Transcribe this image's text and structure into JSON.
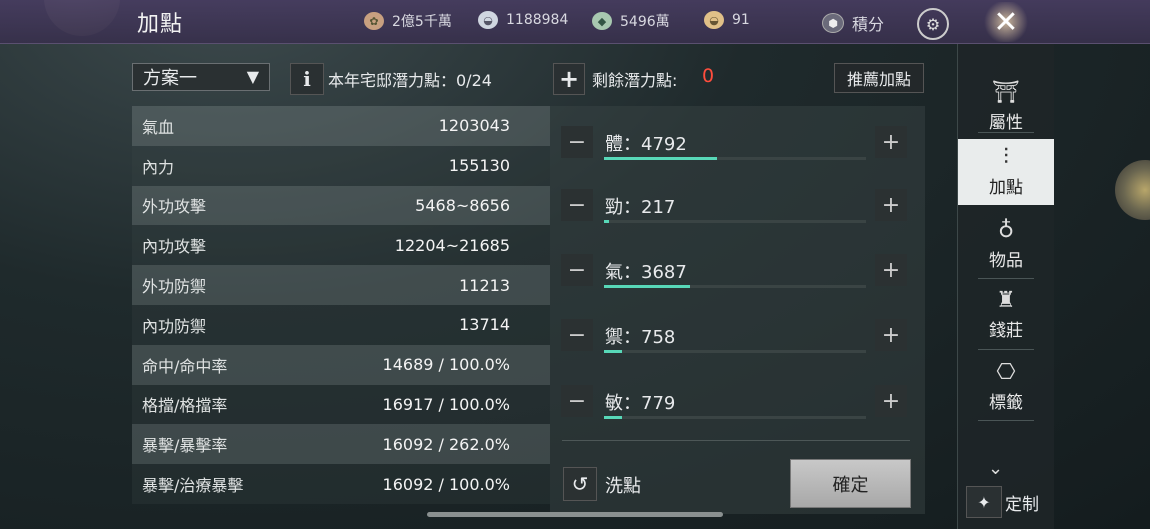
{
  "header": {
    "title": "加點",
    "resources": [
      {
        "icon": "coin-film-icon",
        "value": "2億5千萬"
      },
      {
        "icon": "silver-ingot-icon",
        "value": "1188984"
      },
      {
        "icon": "jade-icon",
        "value": "5496萬"
      },
      {
        "icon": "gold-ingot-icon",
        "value": "91"
      },
      {
        "icon": "shield-badge-icon",
        "value": "積分"
      }
    ]
  },
  "toolbar": {
    "scheme_label": "方案一",
    "potential_label": "本年宅邸潛力點：0/24",
    "remaining_label": "剩餘潛力點:",
    "remaining_value": "0",
    "recommend_label": "推薦加點"
  },
  "stats": [
    {
      "label": "氣血",
      "value": "1203043"
    },
    {
      "label": "內力",
      "value": "155130"
    },
    {
      "label": "外功攻擊",
      "value": "5468~8656"
    },
    {
      "label": "內功攻擊",
      "value": "12204~21685"
    },
    {
      "label": "外功防禦",
      "value": "11213"
    },
    {
      "label": "內功防禦",
      "value": "13714"
    },
    {
      "label": "命中/命中率",
      "value": "14689 / 100.0%"
    },
    {
      "label": "格擋/格擋率",
      "value": "16917 / 100.0%"
    },
    {
      "label": "暴擊/暴擊率",
      "value": "16092 / 262.0%"
    },
    {
      "label": "暴擊/治療暴擊",
      "value": "16092 / 100.0%"
    }
  ],
  "attributes": [
    {
      "label": "體：4792",
      "fill": 0.43
    },
    {
      "label": "勁：217",
      "fill": 0.02
    },
    {
      "label": "氣：3687",
      "fill": 0.33
    },
    {
      "label": "禦：758",
      "fill": 0.07
    },
    {
      "label": "敏：779",
      "fill": 0.07
    }
  ],
  "actions": {
    "reset_label": "洗點",
    "confirm_label": "確定"
  },
  "sidenav": {
    "items": [
      {
        "label": "屬性",
        "icon": "hat-icon"
      },
      {
        "label": "加點",
        "icon": "sliders-icon"
      },
      {
        "label": "物品",
        "icon": "bag-icon"
      },
      {
        "label": "錢莊",
        "icon": "money-bag-icon"
      },
      {
        "label": "標籤",
        "icon": "tag-icon"
      }
    ],
    "custom_label": "定制"
  },
  "colors": {
    "remaining_value": "#ff4d3d",
    "progress_fill": "#58d8b8",
    "active_nav_bg": "#e9ecec"
  }
}
